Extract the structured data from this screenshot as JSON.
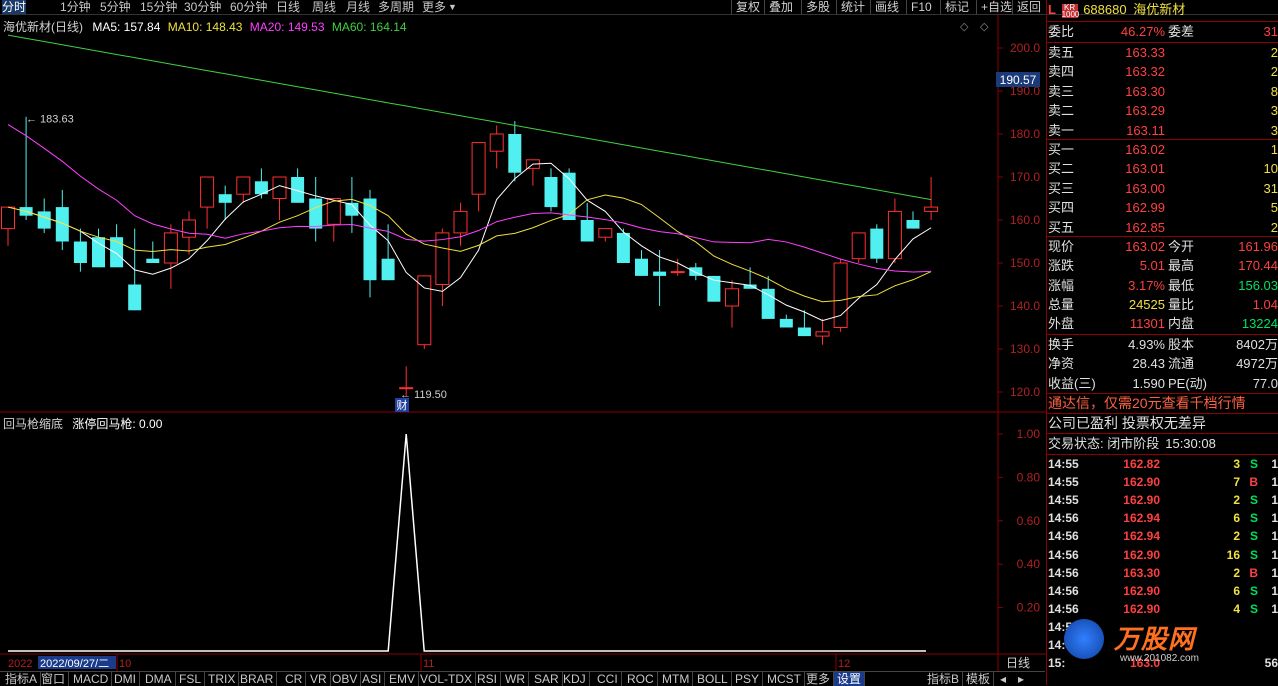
{
  "topbar": {
    "periods": [
      "分时",
      "1分钟",
      "5分钟",
      "15分钟",
      "30分钟",
      "60分钟",
      "日线",
      "周线",
      "月线",
      "多周期",
      "更多"
    ],
    "buttons": [
      "复权",
      "叠加",
      "多股",
      "统计",
      "画线",
      "F10",
      "标记",
      "+自选",
      "返回"
    ]
  },
  "main_chart": {
    "title": "海优新材(日线)",
    "ma5": "MA5: 157.84",
    "ma10": "MA10: 148.43",
    "ma20": "MA20: 149.53",
    "ma60": "MA60: 164.14",
    "high_marker": "183.63",
    "low_marker": "119.50",
    "current_price_tag": "190.57",
    "cai_badge": "财",
    "colors": {
      "ma5": "#ffffff",
      "ma10": "#f0e040",
      "ma20": "#ff40ff",
      "ma60": "#40d040",
      "up": "#ff3030",
      "down": "#50f0f0"
    }
  },
  "sub_chart": {
    "title": "回马枪缩底",
    "indicator": "涨停回马枪: 0.00"
  },
  "chart_data": [
    {
      "type": "candlestick",
      "y_ticks": [
        "200.0",
        "190.0",
        "180.0",
        "170.0",
        "160.0",
        "150.0",
        "140.0",
        "130.0",
        "120.0"
      ],
      "ylim": [
        115,
        205
      ],
      "candles": [
        {
          "o": 158,
          "h": 163,
          "l": 154,
          "c": 163
        },
        {
          "o": 163,
          "h": 184,
          "l": 160,
          "c": 161
        },
        {
          "o": 162,
          "h": 165,
          "l": 157,
          "c": 158
        },
        {
          "o": 163,
          "h": 167,
          "l": 153,
          "c": 155
        },
        {
          "o": 155,
          "h": 158,
          "l": 148,
          "c": 150
        },
        {
          "o": 156,
          "h": 158,
          "l": 152,
          "c": 149
        },
        {
          "o": 156,
          "h": 159,
          "l": 151,
          "c": 149
        },
        {
          "o": 145,
          "h": 158,
          "l": 139,
          "c": 139
        },
        {
          "o": 151,
          "h": 155,
          "l": 150,
          "c": 150
        },
        {
          "o": 150,
          "h": 159,
          "l": 144,
          "c": 157
        },
        {
          "o": 156,
          "h": 162,
          "l": 152,
          "c": 160
        },
        {
          "o": 163,
          "h": 170,
          "l": 158,
          "c": 170
        },
        {
          "o": 166,
          "h": 168,
          "l": 160,
          "c": 164
        },
        {
          "o": 166,
          "h": 170,
          "l": 164,
          "c": 170
        },
        {
          "o": 169,
          "h": 172,
          "l": 165,
          "c": 166
        },
        {
          "o": 165,
          "h": 170,
          "l": 160,
          "c": 170
        },
        {
          "o": 170,
          "h": 172,
          "l": 164,
          "c": 164
        },
        {
          "o": 165,
          "h": 170,
          "l": 155,
          "c": 158
        },
        {
          "o": 159,
          "h": 165,
          "l": 155,
          "c": 165
        },
        {
          "o": 164,
          "h": 170,
          "l": 157,
          "c": 161
        },
        {
          "o": 165,
          "h": 167,
          "l": 142,
          "c": 146
        },
        {
          "o": 151,
          "h": 159,
          "l": 146,
          "c": 146
        },
        {
          "o": 121,
          "h": 126,
          "l": 119,
          "c": 121
        },
        {
          "o": 131,
          "h": 147,
          "l": 130,
          "c": 147
        },
        {
          "o": 145,
          "h": 158,
          "l": 140,
          "c": 157
        },
        {
          "o": 157,
          "h": 164,
          "l": 154,
          "c": 162
        },
        {
          "o": 166,
          "h": 178,
          "l": 162,
          "c": 178
        },
        {
          "o": 176,
          "h": 182,
          "l": 172,
          "c": 180
        },
        {
          "o": 180,
          "h": 183,
          "l": 169,
          "c": 171
        },
        {
          "o": 172,
          "h": 174,
          "l": 168,
          "c": 174
        },
        {
          "o": 170,
          "h": 172,
          "l": 162,
          "c": 163
        },
        {
          "o": 171,
          "h": 172,
          "l": 160,
          "c": 160
        },
        {
          "o": 160,
          "h": 164,
          "l": 155,
          "c": 155
        },
        {
          "o": 156,
          "h": 158,
          "l": 155,
          "c": 158
        },
        {
          "o": 157,
          "h": 158,
          "l": 152,
          "c": 150
        },
        {
          "o": 151,
          "h": 153,
          "l": 147,
          "c": 147
        },
        {
          "o": 148,
          "h": 153,
          "l": 140,
          "c": 147
        },
        {
          "o": 148,
          "h": 151,
          "l": 147,
          "c": 148
        },
        {
          "o": 149,
          "h": 150,
          "l": 146,
          "c": 147
        },
        {
          "o": 147,
          "h": 147,
          "l": 141,
          "c": 141
        },
        {
          "o": 140,
          "h": 146,
          "l": 135,
          "c": 144
        },
        {
          "o": 145,
          "h": 149,
          "l": 144,
          "c": 144
        },
        {
          "o": 144,
          "h": 147,
          "l": 137,
          "c": 137
        },
        {
          "o": 137,
          "h": 138,
          "l": 136,
          "c": 135
        },
        {
          "o": 135,
          "h": 139,
          "l": 133,
          "c": 133
        },
        {
          "o": 133,
          "h": 137,
          "l": 131,
          "c": 134
        },
        {
          "o": 135,
          "h": 151,
          "l": 134,
          "c": 150
        },
        {
          "o": 151,
          "h": 157,
          "l": 150,
          "c": 157
        },
        {
          "o": 158,
          "h": 159,
          "l": 150,
          "c": 151
        },
        {
          "o": 151,
          "h": 165,
          "l": 150,
          "c": 162
        },
        {
          "o": 160,
          "h": 162,
          "l": 158,
          "c": 158
        },
        {
          "o": 162,
          "h": 170,
          "l": 160,
          "c": 163
        }
      ]
    },
    {
      "type": "line",
      "y_ticks": [
        "1.00",
        "0.80",
        "0.60",
        "0.40",
        "0.20"
      ],
      "ylim": [
        0,
        1
      ],
      "values_note": "",
      "spike_index": 22
    }
  ],
  "x_axis": {
    "labels": [
      "2022",
      "2022/09/27/二",
      "10",
      "11",
      "12"
    ],
    "right_label": "日线"
  },
  "right_panel": {
    "logo": "L",
    "code": "688680",
    "name": "海优新材",
    "wei_bi_label": "委比",
    "wei_bi": "46.27%",
    "wei_cha_label": "委差",
    "wei_cha": "31",
    "sells": [
      {
        "label": "卖五",
        "price": "163.33",
        "vol": "2"
      },
      {
        "label": "卖四",
        "price": "163.32",
        "vol": "2"
      },
      {
        "label": "卖三",
        "price": "163.30",
        "vol": "8"
      },
      {
        "label": "卖二",
        "price": "163.29",
        "vol": "3"
      },
      {
        "label": "卖一",
        "price": "163.11",
        "vol": "3"
      }
    ],
    "buys": [
      {
        "label": "买一",
        "price": "163.02",
        "vol": "1"
      },
      {
        "label": "买二",
        "price": "163.01",
        "vol": "10"
      },
      {
        "label": "买三",
        "price": "163.00",
        "vol": "31"
      },
      {
        "label": "买四",
        "price": "162.99",
        "vol": "5"
      },
      {
        "label": "买五",
        "price": "162.85",
        "vol": "2"
      }
    ],
    "quote": [
      {
        "l1": "现价",
        "v1": "163.02",
        "c1": "red",
        "l2": "今开",
        "v2": "161.96",
        "c2": "red"
      },
      {
        "l1": "涨跌",
        "v1": "5.01",
        "c1": "red",
        "l2": "最高",
        "v2": "170.44",
        "c2": "red"
      },
      {
        "l1": "涨幅",
        "v1": "3.17%",
        "c1": "red",
        "l2": "最低",
        "v2": "156.03",
        "c2": "green"
      },
      {
        "l1": "总量",
        "v1": "24525",
        "c1": "yellow",
        "l2": "量比",
        "v2": "1.04",
        "c2": "red"
      },
      {
        "l1": "外盘",
        "v1": "11301",
        "c1": "red",
        "l2": "内盘",
        "v2": "13224",
        "c2": "green"
      }
    ],
    "stats": [
      {
        "l1": "换手",
        "v1": "4.93%",
        "l2": "股本",
        "v2": "8402万"
      },
      {
        "l1": "净资",
        "v1": "28.43",
        "l2": "流通",
        "v2": "4972万"
      },
      {
        "l1": "收益(三)",
        "v1": "1.590",
        "l2": "PE(动)",
        "v2": "77.0"
      }
    ],
    "promo": "通达信，仅需20元查看千档行情",
    "notice": "公司已盈利 投票权无差异",
    "status_label": "交易状态: 闭市阶段",
    "status_time": "15:30:08",
    "ticks": [
      {
        "t": "14:55",
        "p": "162.82",
        "v": "3",
        "s": "S",
        "n": "1"
      },
      {
        "t": "14:55",
        "p": "162.90",
        "v": "7",
        "s": "B",
        "n": "1"
      },
      {
        "t": "14:55",
        "p": "162.90",
        "v": "2",
        "s": "S",
        "n": "1"
      },
      {
        "t": "14:56",
        "p": "162.94",
        "v": "6",
        "s": "S",
        "n": "1"
      },
      {
        "t": "14:56",
        "p": "162.94",
        "v": "2",
        "s": "S",
        "n": "1"
      },
      {
        "t": "14:56",
        "p": "162.90",
        "v": "16",
        "s": "S",
        "n": "1"
      },
      {
        "t": "14:56",
        "p": "163.30",
        "v": "2",
        "s": "B",
        "n": "1"
      },
      {
        "t": "14:56",
        "p": "162.90",
        "v": "6",
        "s": "S",
        "n": "1"
      },
      {
        "t": "14:56",
        "p": "162.90",
        "v": "4",
        "s": "S",
        "n": "1"
      },
      {
        "t": "14:5",
        "p": "",
        "v": "",
        "s": "",
        "n": ""
      },
      {
        "t": "14:5",
        "p": "",
        "v": "",
        "s": "",
        "n": ""
      },
      {
        "t": "15:",
        "p": "163.0",
        "v": "",
        "s": "",
        "n": "56"
      }
    ],
    "watermark": "万股网",
    "watermark_url": "www.201082.com"
  },
  "bottombar": {
    "items": [
      "指标A",
      "窗口",
      "MACD",
      "DMI",
      "DMA",
      "FSL",
      "TRIX",
      "BRAR",
      "CR",
      "VR",
      "OBV",
      "ASI",
      "EMV",
      "VOL-TDX",
      "RSI",
      "WR",
      "SAR",
      "KDJ",
      "CCI",
      "ROC",
      "MTM",
      "BOLL",
      "PSY",
      "MCST",
      "更多",
      "设置"
    ],
    "right": [
      "指标B",
      "模板"
    ]
  }
}
